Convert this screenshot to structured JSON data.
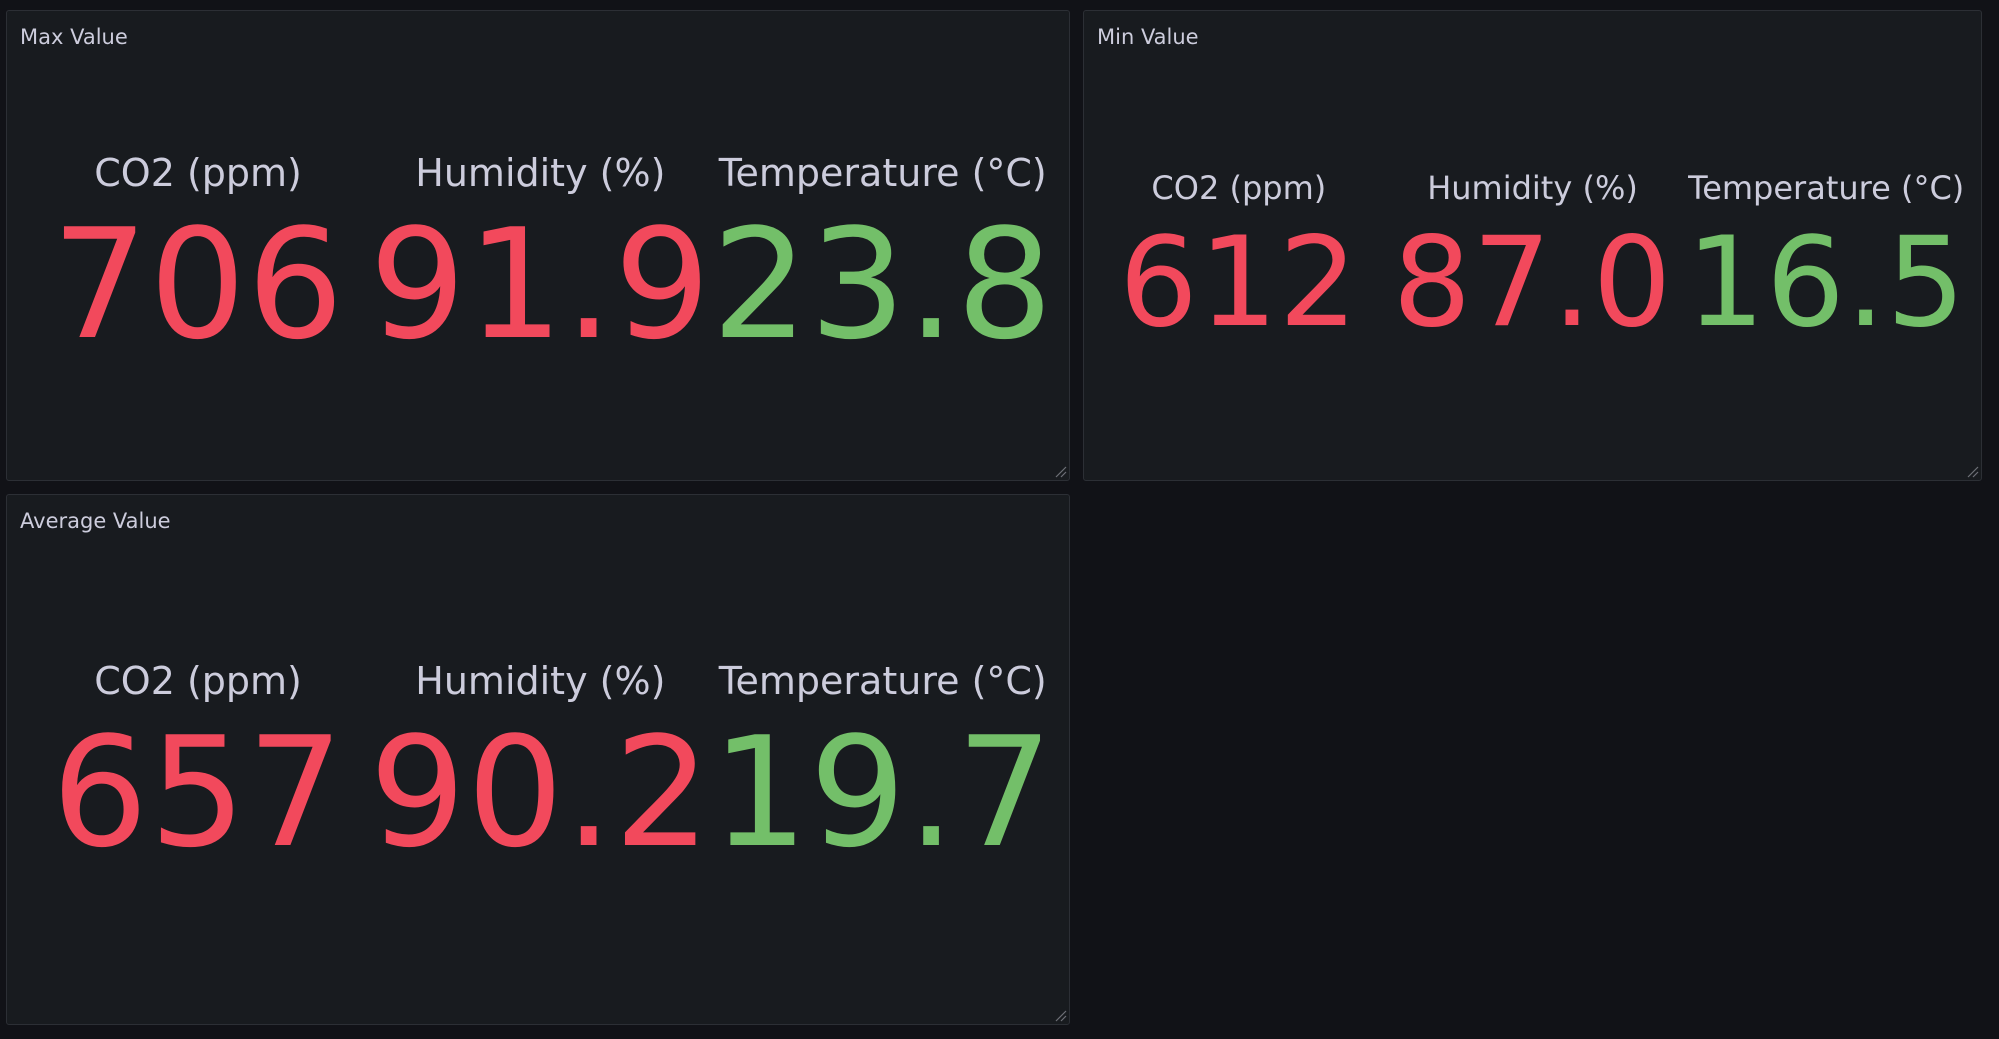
{
  "colors": {
    "background": "#111217",
    "panel": "#181b1f",
    "label": "#ccccdc",
    "red": "#f2495c",
    "green": "#73bf69"
  },
  "panels": {
    "max": {
      "title": "Max Value",
      "stats": [
        {
          "label": "CO2 (ppm)",
          "value": "706",
          "color": "#f2495c"
        },
        {
          "label": "Humidity (%)",
          "value": "91.9",
          "color": "#f2495c"
        },
        {
          "label": "Temperature (°C)",
          "value": "23.8",
          "color": "#73bf69"
        }
      ]
    },
    "min": {
      "title": "Min Value",
      "stats": [
        {
          "label": "CO2 (ppm)",
          "value": "612",
          "color": "#f2495c"
        },
        {
          "label": "Humidity (%)",
          "value": "87.0",
          "color": "#f2495c"
        },
        {
          "label": "Temperature (°C)",
          "value": "16.5",
          "color": "#73bf69"
        }
      ]
    },
    "avg": {
      "title": "Average Value",
      "stats": [
        {
          "label": "CO2 (ppm)",
          "value": "657",
          "color": "#f2495c"
        },
        {
          "label": "Humidity (%)",
          "value": "90.2",
          "color": "#f2495c"
        },
        {
          "label": "Temperature (°C)",
          "value": "19.7",
          "color": "#73bf69"
        }
      ]
    }
  },
  "icons": {
    "resize": "resize-handle-icon"
  }
}
